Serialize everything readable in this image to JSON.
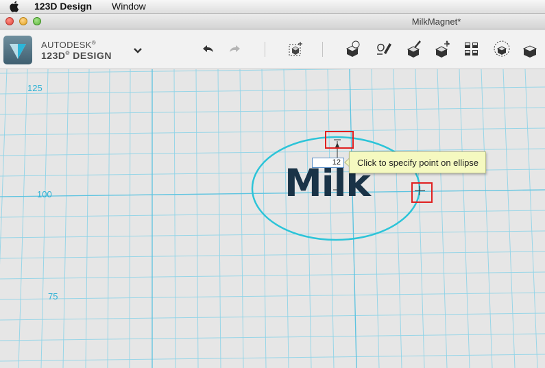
{
  "menubar": {
    "app_name": "123D Design",
    "window_menu": "Window"
  },
  "window": {
    "title": "MilkMagnet*"
  },
  "toolbar": {
    "brand_top": "AUTODESK",
    "brand_bottom": "123D",
    "brand_bottom_suffix": "DESIGN",
    "tools": [
      {
        "icon": "undo-icon"
      },
      {
        "icon": "redo-icon"
      },
      {
        "icon": "transform-icon"
      },
      {
        "icon": "primitives-icon"
      },
      {
        "icon": "sketch-icon"
      },
      {
        "icon": "construct-icon"
      },
      {
        "icon": "modify-icon"
      },
      {
        "icon": "pattern-icon"
      },
      {
        "icon": "group-icon"
      },
      {
        "icon": "combine-icon"
      }
    ]
  },
  "canvas": {
    "axis_labels": [
      "125",
      "100",
      "75"
    ],
    "text_object": "Milk",
    "dimension_value": "12",
    "tooltip": "Click to specify point on ellipse"
  },
  "colors": {
    "grid": "#7fd0e6",
    "ellipse": "#2cc4d8",
    "milk": "#1a3347",
    "handle": "#e02020",
    "tooltip_bg": "#f5f9c0"
  }
}
